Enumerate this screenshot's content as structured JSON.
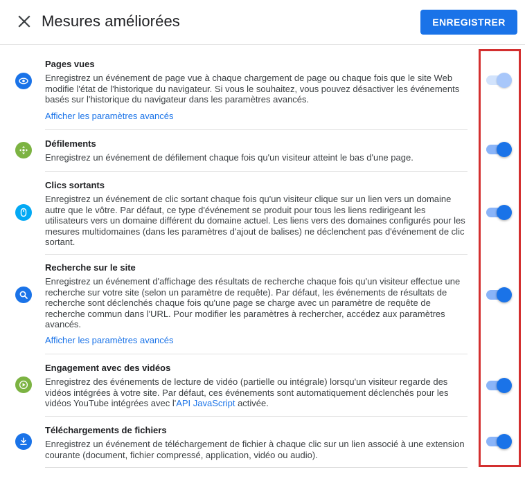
{
  "header": {
    "title": "Mesures améliorées",
    "save_label": "ENREGISTRER"
  },
  "sections": [
    {
      "title": "Pages vues",
      "description": "Enregistrez un événement de page vue à chaque chargement de page ou chaque fois que le site Web modifie l'état de l'historique du navigateur. Si vous le souhaitez, vous pouvez désactiver les événements basés sur l'historique du navigateur dans les paramètres avancés.",
      "link": "Afficher les paramètres avancés",
      "icon": "eye-icon",
      "icon_color": "#1a73e8",
      "toggle_on": true,
      "toggle_disabled": true
    },
    {
      "title": "Défilements",
      "description": "Enregistrez un événement de défilement chaque fois qu'un visiteur atteint le bas d'une page.",
      "icon": "scroll-icon",
      "icon_color": "#7cb342",
      "toggle_on": true
    },
    {
      "title": "Clics sortants",
      "description": "Enregistrez un événement de clic sortant chaque fois qu'un visiteur clique sur un lien vers un domaine autre que le vôtre. Par défaut, ce type d'événement se produit pour tous les liens redirigeant les utilisateurs vers un domaine différent du domaine actuel. Les liens vers des domaines configurés pour les mesures multidomaines (dans les paramètres d'ajout de balises) ne déclenchent pas d'événement de clic sortant.",
      "icon": "mouse-icon",
      "icon_color": "#03a9f4",
      "toggle_on": true
    },
    {
      "title": "Recherche sur le site",
      "description": "Enregistrez un événement d'affichage des résultats de recherche chaque fois qu'un visiteur effectue une recherche sur votre site (selon un paramètre de requête). Par défaut, les événements de résultats de recherche sont déclenchés chaque fois qu'une page se charge avec un paramètre de requête de recherche commun dans l'URL. Pour modifier les paramètres à rechercher, accédez aux paramètres avancés.",
      "link": "Afficher les paramètres avancés",
      "icon": "search-icon",
      "icon_color": "#1a73e8",
      "toggle_on": true
    },
    {
      "title": "Engagement avec des vidéos",
      "description_before": "Enregistrez des événements de lecture de vidéo (partielle ou intégrale) lorsqu'un visiteur regarde des vidéos intégrées à votre site. Par défaut, ces événements sont automatiquement déclenchés pour les vidéos YouTube intégrées avec l'",
      "description_link": "API JavaScript",
      "description_after": " activée.",
      "icon": "play-icon",
      "icon_color": "#7cb342",
      "toggle_on": true
    },
    {
      "title": "Téléchargements de fichiers",
      "description": "Enregistrez un événement de téléchargement de fichier à chaque clic sur un lien associé à une extension courante (document, fichier compressé, application, vidéo ou audio).",
      "icon": "download-icon",
      "icon_color": "#1a73e8",
      "toggle_on": true
    }
  ],
  "colors": {
    "primary": "#1a73e8",
    "highlight_border": "#d32f2f"
  }
}
